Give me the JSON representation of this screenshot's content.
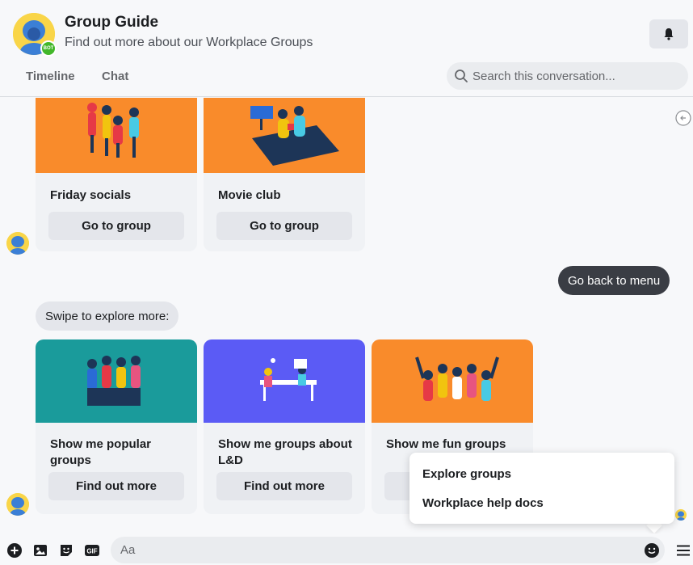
{
  "header": {
    "title": "Group Guide",
    "subtitle": "Find out more about our Workplace Groups",
    "bot_badge": "BOT",
    "tabs": [
      {
        "label": "Timeline"
      },
      {
        "label": "Chat"
      }
    ],
    "search_placeholder": "Search this conversation..."
  },
  "icons": {
    "bell": "bell-icon",
    "search": "search-icon",
    "back": "arrow-left-circle-icon",
    "composer": [
      "plus-circle-icon",
      "photo-icon",
      "sticker-icon",
      "gif-icon",
      "emoji-icon",
      "menu-icon"
    ]
  },
  "messages": {
    "first_carousel": [
      {
        "title": "Friday socials",
        "button": "Go to group",
        "color": "#f98b2b"
      },
      {
        "title": "Movie club",
        "button": "Go to group",
        "color": "#f98b2b"
      }
    ],
    "outgoing": "Go back to menu",
    "incoming": "Swipe to explore more:",
    "second_carousel": [
      {
        "title": "Show me popular groups",
        "button": "Find out more",
        "color": "#1a9b9b"
      },
      {
        "title": "Show me groups about L&D",
        "button": "Find out more",
        "color": "#5b5bf5"
      },
      {
        "title": "Show me fun groups",
        "button": "",
        "color": "#f98b2b"
      }
    ]
  },
  "popup_menu": {
    "items": [
      {
        "label": "Explore groups"
      },
      {
        "label": "Workplace help docs"
      }
    ]
  },
  "composer": {
    "gif_label": "GIF",
    "placeholder": "Aa"
  },
  "colors": {
    "outgoing_bubble": "#3a3d44",
    "card_bg": "#f0f2f5",
    "button_bg": "#e4e6eb"
  }
}
